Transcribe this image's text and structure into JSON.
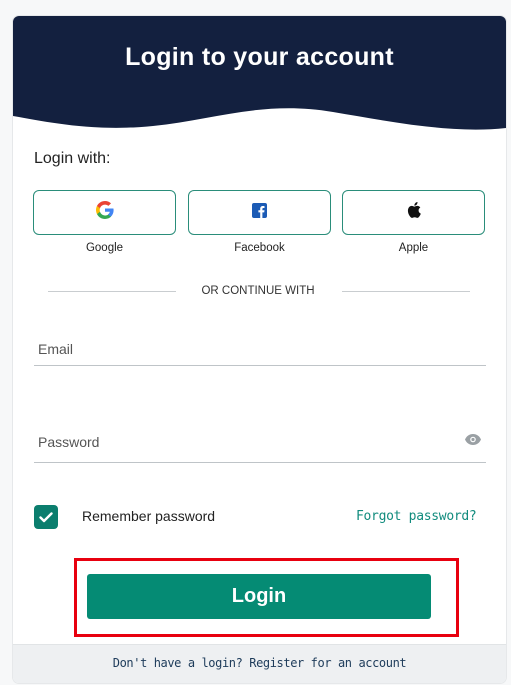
{
  "header": {
    "title": "Login to your account",
    "bg_color": "#13203f"
  },
  "login_with_label": "Login with:",
  "social": [
    {
      "label": "Google",
      "icon": "google-icon"
    },
    {
      "label": "Facebook",
      "icon": "facebook-icon"
    },
    {
      "label": "Apple",
      "icon": "apple-icon"
    }
  ],
  "divider_text": "OR CONTINUE WITH",
  "email": {
    "placeholder": "Email",
    "value": ""
  },
  "password": {
    "placeholder": "Password",
    "value": "",
    "icon": "eye-icon"
  },
  "remember": {
    "label": "Remember password",
    "checked": true
  },
  "forgot_link": "Forgot password?",
  "login_button": "Login",
  "footer_text": "Don't have a login? Register for an account",
  "colors": {
    "accent": "#058b74",
    "highlight_border": "#e8000f",
    "link": "#128c7e"
  }
}
